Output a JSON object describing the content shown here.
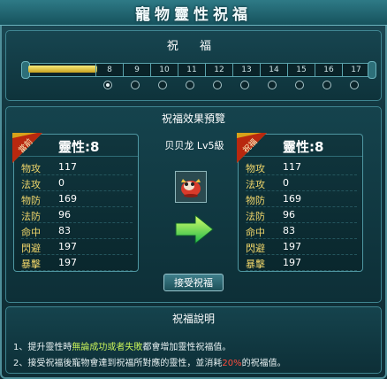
{
  "window": {
    "title": "寵物靈性祝福"
  },
  "bless": {
    "label": "祝 福",
    "progress_fraction": 0.2,
    "levels": [
      "8",
      "9",
      "10",
      "11",
      "12",
      "13",
      "14",
      "15",
      "16",
      "17"
    ],
    "dots": 10,
    "active_dot": 0
  },
  "preview": {
    "title": "祝福效果預覽",
    "pet_name": "贝贝龙 Lv5級",
    "before": {
      "tag": "當前",
      "spirit_label": "靈性:",
      "spirit_value": "8",
      "stats": [
        {
          "name": "物攻",
          "value": "117"
        },
        {
          "name": "法攻",
          "value": "0"
        },
        {
          "name": "物防",
          "value": "169"
        },
        {
          "name": "法防",
          "value": "96"
        },
        {
          "name": "命中",
          "value": "83"
        },
        {
          "name": "閃避",
          "value": "197"
        },
        {
          "name": "暴擊",
          "value": "197"
        }
      ]
    },
    "after": {
      "tag": "祝福",
      "spirit_label": "靈性:",
      "spirit_value": "8",
      "stats": [
        {
          "name": "物攻",
          "value": "117"
        },
        {
          "name": "法攻",
          "value": "0"
        },
        {
          "name": "物防",
          "value": "169"
        },
        {
          "name": "法防",
          "value": "96"
        },
        {
          "name": "命中",
          "value": "83"
        },
        {
          "name": "閃避",
          "value": "197"
        },
        {
          "name": "暴擊",
          "value": "197"
        }
      ]
    },
    "accept_label": "接受祝福"
  },
  "description": {
    "title": "祝福說明",
    "line1": {
      "prefix": "1、提升靈性時",
      "highlight": "無論成功或者失敗",
      "suffix": "都會增加靈性祝福值。"
    },
    "line2": {
      "prefix": "2、接受祝福後寵物會達到祝福所對應的靈性，並消耗",
      "highlight": "20%",
      "suffix": "的祝福值。"
    }
  },
  "colors": {
    "accent": "#4f8f9a",
    "stat_label": "#f0d66a",
    "highlight_green": "#c8f25a",
    "highlight_red": "#ff4b3c",
    "progress": "#e6cf4a"
  }
}
